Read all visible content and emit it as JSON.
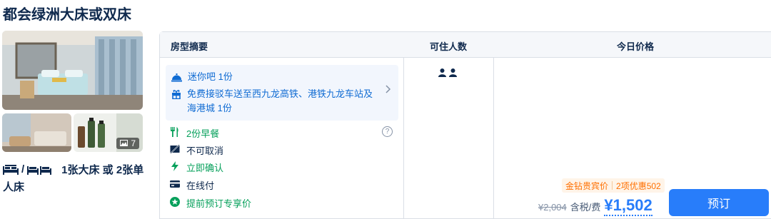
{
  "room": {
    "title": "都会绿洲大床或双床",
    "photo_count": "7",
    "bed_separator": "/",
    "bed_desc_line1": "1张大床 或 2张单",
    "bed_desc_line2": "人床"
  },
  "table": {
    "headers": {
      "summary": "房型摘要",
      "guests": "可住人数",
      "price": "今日价格"
    },
    "amenities": [
      {
        "icon": "bell-service-icon",
        "text": "迷你吧 1份"
      },
      {
        "icon": "gift-icon",
        "text": "免费接驳车送至西九龙高铁、港铁九龙车站及海港城 1份"
      }
    ],
    "policies": [
      {
        "icon": "fork-knife-icon",
        "text": "2份早餐",
        "color": "#06a05b"
      },
      {
        "icon": "no-cancel-icon",
        "text": "不可取消",
        "color": "#0f294d"
      },
      {
        "icon": "lightning-icon",
        "text": "立即确认",
        "color": "#06a05b"
      },
      {
        "icon": "card-icon",
        "text": "在线付",
        "color": "#0f294d"
      },
      {
        "icon": "star-badge-icon",
        "text": "提前预订专享价",
        "color": "#06a05b"
      }
    ],
    "help_glyph": "?"
  },
  "price": {
    "promo_member": "金钻贵宾价",
    "promo_offers": "2项优惠502",
    "original": "¥2,004",
    "tax_label": "含税/费",
    "current": "¥1,502",
    "book_label": "预订"
  },
  "colors": {
    "accent": "#287dfa",
    "green": "#06a05b",
    "promo": "#ff6f00",
    "text": "#0f294d"
  }
}
